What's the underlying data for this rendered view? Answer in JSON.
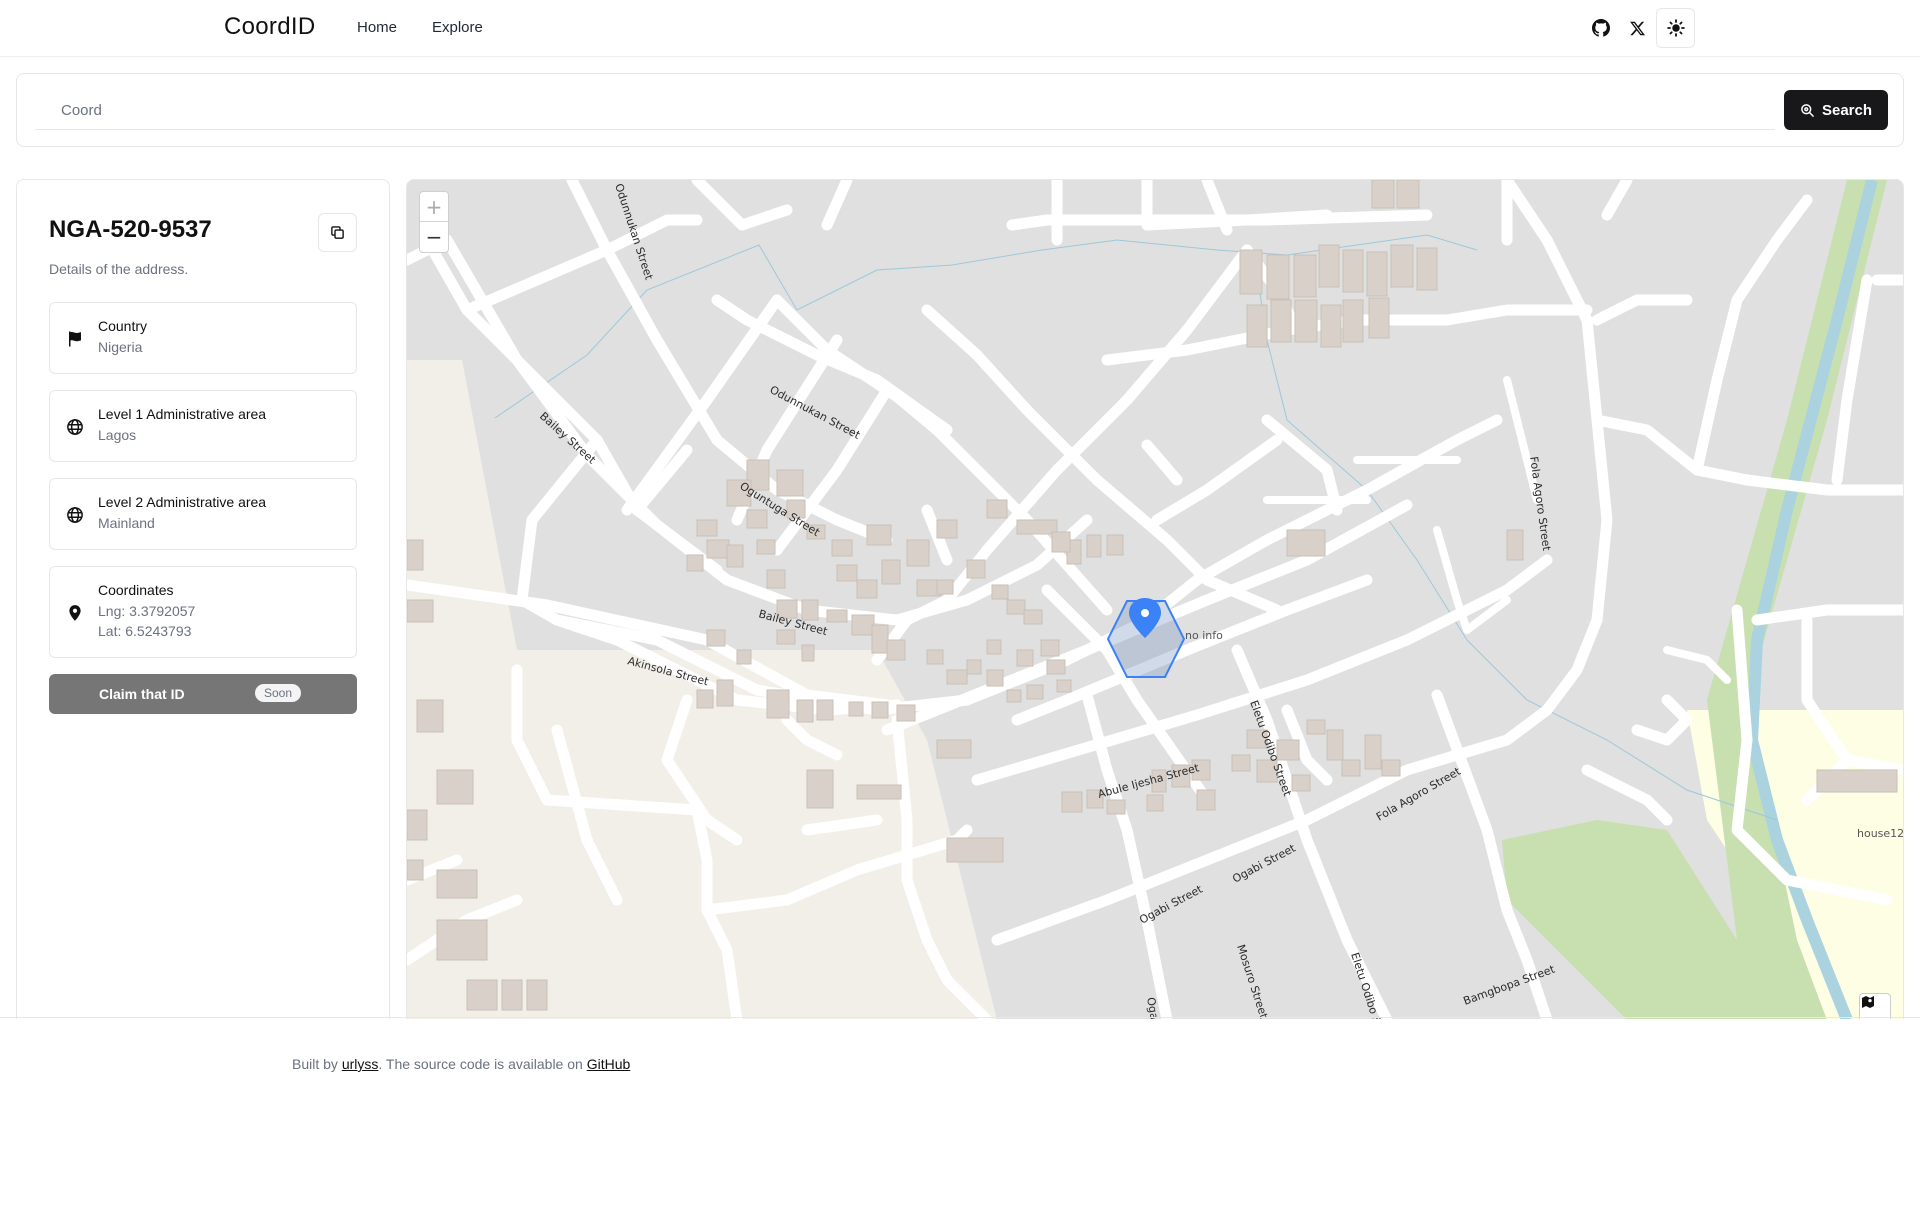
{
  "header": {
    "brand": "CoordID",
    "nav": [
      "Home",
      "Explore"
    ],
    "icons": [
      "github-icon",
      "x-icon",
      "sun-icon"
    ]
  },
  "search": {
    "placeholder": "Coord",
    "button_label": "Search"
  },
  "details": {
    "id": "NGA-520-9537",
    "subtitle": "Details of the address.",
    "country": {
      "title": "Country",
      "value": "Nigeria"
    },
    "admin1": {
      "title": "Level 1 Administrative area",
      "value": "Lagos"
    },
    "admin2": {
      "title": "Level 2 Administrative area",
      "value": "Mainland"
    },
    "coordinates": {
      "title": "Coordinates",
      "lng": "Lng: 3.3792057",
      "lat": "Lat: 6.5243793"
    },
    "claim": {
      "label": "Claim that ID",
      "badge": "Soon"
    }
  },
  "map": {
    "zoom_in": "+",
    "zoom_out": "−",
    "place_labels": {
      "no_info": "no info",
      "house12": "house12"
    },
    "streets": {
      "odunnukan_1": "Odunnukan Street",
      "odunnukan_2": "Odunnukan Street",
      "bailey_1": "Bailey Street",
      "bailey_2": "Bailey Street",
      "oguntuga": "Oguntuga Street",
      "akinsola": "Akinsola Street",
      "fola_agoro_1": "Fola Agoro Street",
      "fola_agoro_2": "Fola Agoro Street",
      "abule_ijesha": "Abule Ijesha Street",
      "eletu_odibo_1": "Eletu Odibo Street",
      "eletu_odibo_2": "Eletu Odibo S",
      "ogabi_1": "Ogabi Street",
      "ogabi_2": "Ogabi Street",
      "mosuro": "Mosuro Street",
      "bamgbopa": "Bamgbopa Street",
      "oga": "Oga"
    },
    "colors": {
      "road": "#ffffff",
      "block": "#e0e0e0",
      "building": "#d9d0c9",
      "water": "#aad3df",
      "park": "#c8dfb0",
      "residential": "#fefee5",
      "marker": "#3b82f6"
    }
  },
  "footer": {
    "prefix": "Built by ",
    "author": "urlyss",
    "middle": ". The source code is available on ",
    "link": "GitHub"
  }
}
